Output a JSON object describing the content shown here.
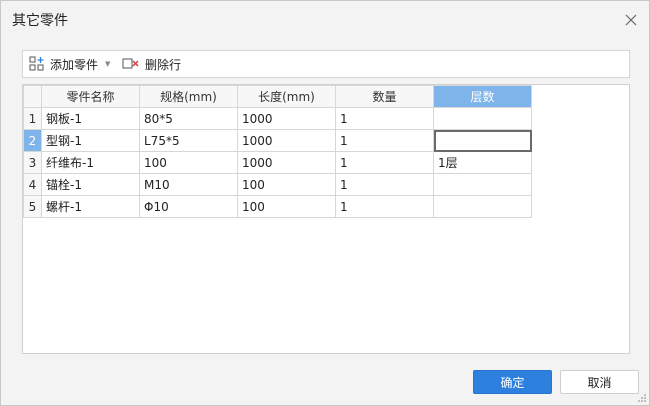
{
  "dialog": {
    "title": "其它零件"
  },
  "toolbar": {
    "add_part_label": "添加零件",
    "delete_row_label": "删除行"
  },
  "table": {
    "columns": [
      "零件名称",
      "规格(mm)",
      "长度(mm)",
      "数量",
      "层数"
    ],
    "rows": [
      {
        "num": "1",
        "cells": [
          "钢板-1",
          "80*5",
          "1000",
          "1",
          ""
        ]
      },
      {
        "num": "2",
        "cells": [
          "型钢-1",
          "L75*5",
          "1000",
          "1",
          ""
        ]
      },
      {
        "num": "3",
        "cells": [
          "纤维布-1",
          "100",
          "1000",
          "1",
          "1层"
        ]
      },
      {
        "num": "4",
        "cells": [
          "锚栓-1",
          "M10",
          "100",
          "1",
          ""
        ]
      },
      {
        "num": "5",
        "cells": [
          "螺杆-1",
          "Φ10",
          "100",
          "1",
          ""
        ]
      }
    ]
  },
  "buttons": {
    "ok_label": "确定",
    "cancel_label": "取消"
  },
  "colors": {
    "accent": "#2e80df",
    "header_active": "#7fb4ea"
  }
}
